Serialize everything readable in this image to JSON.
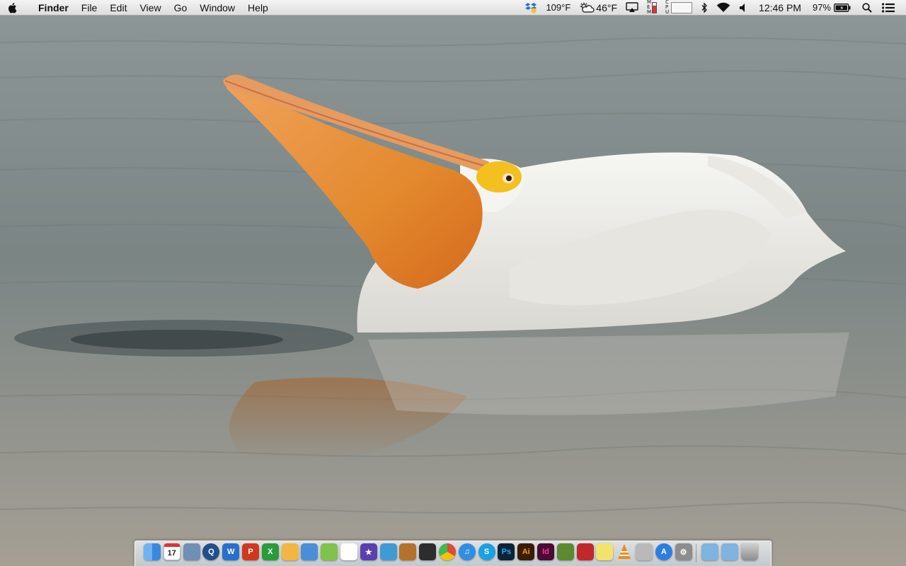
{
  "menubar": {
    "app_name": "Finder",
    "menus": [
      "File",
      "Edit",
      "View",
      "Go",
      "Window",
      "Help"
    ],
    "status": {
      "cpu_temp": "109°F",
      "weather_temp": "46°F",
      "battery_percent": "97%",
      "clock": "12:46 PM"
    },
    "icons": [
      "apple-icon",
      "dropbox-icon",
      "weather-icon",
      "airplay-icon",
      "memory-meter-icon",
      "cpu-meter-icon",
      "bluetooth-icon",
      "wifi-icon",
      "volume-icon",
      "battery-icon",
      "spotlight-icon",
      "notification-center-icon"
    ]
  },
  "wallpaper": {
    "subject": "pelican",
    "colors": {
      "water_top": "#8e9797",
      "water_mid": "#7a8584",
      "water_bottom": "#a59f94",
      "bird": "#f1f1ee",
      "pouch": "#e3892e",
      "bill": "#d98a52",
      "eye_ring": "#f3c020"
    }
  },
  "dock": {
    "apps": [
      {
        "name": "Finder",
        "icon": "finder-icon",
        "glyph": "",
        "color": "#3a87e0"
      },
      {
        "name": "Calendar",
        "icon": "calendar-icon",
        "glyph": "17",
        "color": "#ffffff"
      },
      {
        "name": "Preview",
        "icon": "preview-icon",
        "glyph": "",
        "color": "#6f8fb5"
      },
      {
        "name": "QuickTime",
        "icon": "quicktime-icon",
        "glyph": "Q",
        "color": "#1f4f8c"
      },
      {
        "name": "Word",
        "icon": "word-icon",
        "glyph": "W",
        "color": "#2a6fcf"
      },
      {
        "name": "PowerPoint",
        "icon": "powerpoint-icon",
        "glyph": "P",
        "color": "#d0381e"
      },
      {
        "name": "Excel",
        "icon": "excel-icon",
        "glyph": "X",
        "color": "#2a9b3b"
      },
      {
        "name": "Pages",
        "icon": "pages-icon",
        "glyph": "",
        "color": "#f3b640"
      },
      {
        "name": "Keynote",
        "icon": "keynote-icon",
        "glyph": "",
        "color": "#4a8ed8"
      },
      {
        "name": "Numbers",
        "icon": "numbers-icon",
        "glyph": "",
        "color": "#7fc34a"
      },
      {
        "name": "Acrobat",
        "icon": "acrobat-icon",
        "glyph": "",
        "color": "#ffffff"
      },
      {
        "name": "iMovie",
        "icon": "imovie-icon",
        "glyph": "★",
        "color": "#5a3fb0"
      },
      {
        "name": "iPhoto",
        "icon": "iphoto-icon",
        "glyph": "",
        "color": "#3f9ad6"
      },
      {
        "name": "GarageBand",
        "icon": "garageband-icon",
        "glyph": "",
        "color": "#b5722c"
      },
      {
        "name": "DVD Player",
        "icon": "dvd-player-icon",
        "glyph": "",
        "color": "#2d2d2d"
      },
      {
        "name": "Chrome",
        "icon": "chrome-icon",
        "glyph": "",
        "color": "#dd4b39"
      },
      {
        "name": "iTunes",
        "icon": "itunes-icon",
        "glyph": "♫",
        "color": "#2f8fe0"
      },
      {
        "name": "Skype",
        "icon": "skype-icon",
        "glyph": "S",
        "color": "#1aa0e6"
      },
      {
        "name": "Photoshop",
        "icon": "photoshop-icon",
        "glyph": "Ps",
        "color": "#0b2438"
      },
      {
        "name": "Illustrator",
        "icon": "illustrator-icon",
        "glyph": "Ai",
        "color": "#3a1c00"
      },
      {
        "name": "InDesign",
        "icon": "indesign-icon",
        "glyph": "Id",
        "color": "#4a0a33"
      },
      {
        "name": "Minecraft",
        "icon": "minecraft-icon",
        "glyph": "",
        "color": "#5b8a30"
      },
      {
        "name": "Photo Booth",
        "icon": "photobooth-icon",
        "glyph": "",
        "color": "#c0282a"
      },
      {
        "name": "Stickies",
        "icon": "stickies-icon",
        "glyph": "",
        "color": "#f2e36a"
      },
      {
        "name": "VLC",
        "icon": "vlc-icon",
        "glyph": "",
        "color": "#f08a1c"
      },
      {
        "name": "Calculator",
        "icon": "calculator-icon",
        "glyph": "",
        "color": "#b9b9b9"
      },
      {
        "name": "App Store",
        "icon": "app-store-icon",
        "glyph": "A",
        "color": "#2a7fe0"
      },
      {
        "name": "System Preferences",
        "icon": "system-preferences-icon",
        "glyph": "⚙",
        "color": "#8d8d8d"
      }
    ],
    "stacks": [
      {
        "name": "Applications",
        "icon": "applications-folder-icon",
        "color": "#7fb3e0"
      },
      {
        "name": "Downloads",
        "icon": "downloads-folder-icon",
        "color": "#7fb3e0"
      },
      {
        "name": "Trash",
        "icon": "trash-icon",
        "color": "#a8a8a8"
      }
    ]
  }
}
